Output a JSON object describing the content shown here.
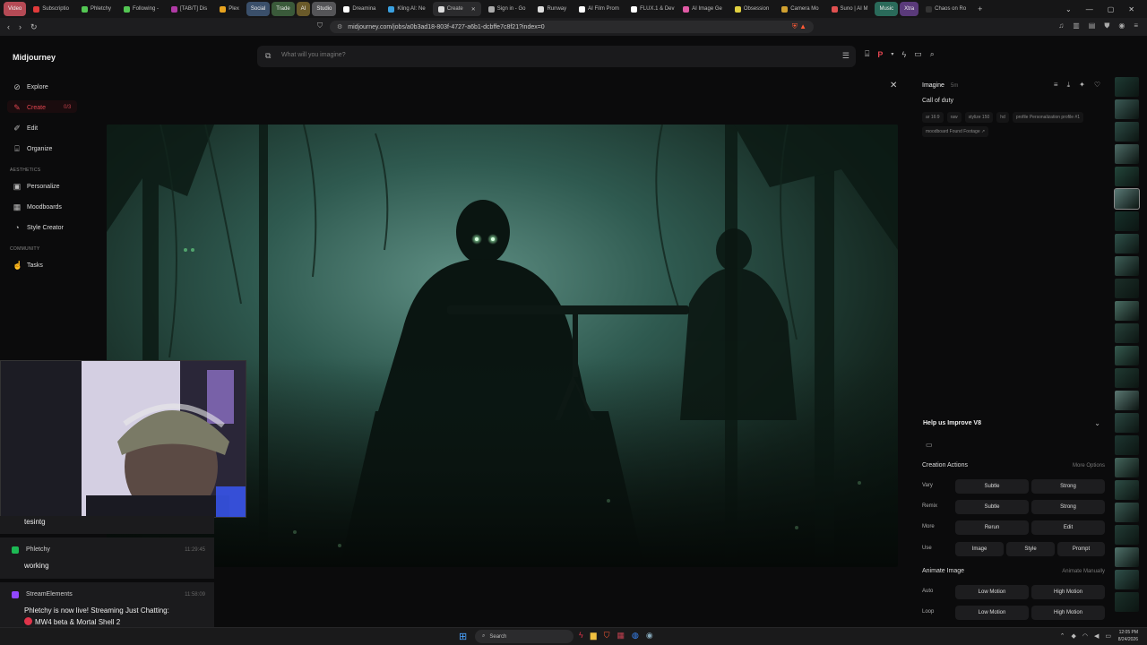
{
  "browser": {
    "tabs": [
      {
        "label": "Video",
        "color": "#b54a55",
        "group": true
      },
      {
        "label": "Subscriptio",
        "color": "#e13b3b"
      },
      {
        "label": "Phletchy",
        "color": "#53c653"
      },
      {
        "label": "Following -",
        "color": "#53c653"
      },
      {
        "label": "[TAB/T] Dis",
        "color": "#b03aa5"
      },
      {
        "label": "Plex",
        "color": "#e7a31f"
      },
      {
        "label": "Social",
        "color": "#3a4f6a",
        "group": true
      },
      {
        "label": "Trade",
        "color": "#3a5a3a",
        "group": true
      },
      {
        "label": "AI",
        "color": "#6a5a2a",
        "group": true
      },
      {
        "label": "Studio",
        "color": "#555558",
        "group": true
      },
      {
        "label": "Dreamina",
        "color": "#ffffff"
      },
      {
        "label": "Kling AI: Ne",
        "color": "#3aa0e0"
      },
      {
        "label": "Create",
        "color": "#dddddd",
        "active": true
      },
      {
        "label": "Sign in - Go",
        "color": "#aaaaaa"
      },
      {
        "label": "Runway",
        "color": "#dddddd"
      },
      {
        "label": "AI Film Prom",
        "color": "#ffffff"
      },
      {
        "label": "FLUX.1 & Dev",
        "color": "#ffffff"
      },
      {
        "label": "AI Image Ge",
        "color": "#e05aa5"
      },
      {
        "label": "Obsession",
        "color": "#e0d040"
      },
      {
        "label": "Camera Mo",
        "color": "#d0a030"
      },
      {
        "label": "Suno | AI M",
        "color": "#e05050"
      },
      {
        "label": "Music",
        "color": "#2a6a5a",
        "group": true
      },
      {
        "label": "Xtra",
        "color": "#5a3a7a",
        "group": true
      },
      {
        "label": "Chaos on Ro",
        "color": "#333333"
      }
    ],
    "url": "midjourney.com/jobs/a0b3ad18-803f-4727-a6b1-dcbffe7c8f21?index=0"
  },
  "sidebar": {
    "brand": "Midjourney",
    "items": [
      {
        "label": "Explore",
        "icon": "compass-icon",
        "glyph": "⊘"
      },
      {
        "label": "Create",
        "icon": "paintbrush-icon",
        "glyph": "✎",
        "count": "0/3"
      },
      {
        "label": "Edit",
        "icon": "edit-icon",
        "glyph": "✐"
      },
      {
        "label": "Organize",
        "icon": "folder-icon",
        "glyph": "⌸"
      }
    ],
    "aesthetics_label": "AESTHETICS",
    "aesthetics": [
      {
        "label": "Personalize",
        "icon": "personalize-icon",
        "glyph": "▣"
      },
      {
        "label": "Moodboards",
        "icon": "moodboard-icon",
        "glyph": "▦"
      },
      {
        "label": "Style Creator",
        "icon": "palette-icon",
        "glyph": "◔"
      }
    ],
    "community_label": "COMMUNITY",
    "community": [
      {
        "label": "Tasks",
        "icon": "thumbs-up-icon",
        "glyph": "☝"
      }
    ]
  },
  "prompt": {
    "placeholder": "What will you imagine?"
  },
  "details": {
    "title": "Imagine",
    "age": "5m",
    "prompt": "Call of duty",
    "chips": [
      "ar 16:9",
      "raw",
      "stylize 150",
      "hd",
      "profile Personalization profile #1",
      "moodboard Found Footage"
    ],
    "help": "Help us Improve V8",
    "creation_actions": "Creation Actions",
    "more_options": "More Options",
    "rows": [
      {
        "label": "Vary",
        "buttons": [
          "Subtle",
          "Strong"
        ]
      },
      {
        "label": "Remix",
        "buttons": [
          "Subtle",
          "Strong"
        ]
      },
      {
        "label": "More",
        "buttons": [
          "Rerun",
          "Edit"
        ]
      },
      {
        "label": "Use",
        "buttons": [
          "Image",
          "Style",
          "Prompt"
        ]
      }
    ],
    "animate_title": "Animate Image",
    "animate_manually": "Animate Manually",
    "animate_rows": [
      {
        "label": "Auto",
        "buttons": [
          "Low Motion",
          "High Motion"
        ]
      },
      {
        "label": "Loop",
        "buttons": [
          "Low Motion",
          "High Motion"
        ]
      }
    ]
  },
  "chat": [
    {
      "name": "",
      "time": "",
      "text": "tesintg",
      "badge": ""
    },
    {
      "name": "Phletchy",
      "time": "11:29:45",
      "text": "working",
      "badge": "#1db954"
    },
    {
      "name": "StreamElements",
      "time": "11:58:09",
      "text": "Phletchy is now live! Streaming Just Chatting:",
      "text2": "MW4 beta & Mortal Shell 2",
      "badge": "#9147ff"
    }
  ],
  "taskbar": {
    "search": "Search",
    "time": "12:05 PM",
    "date": "8/24/2026"
  }
}
